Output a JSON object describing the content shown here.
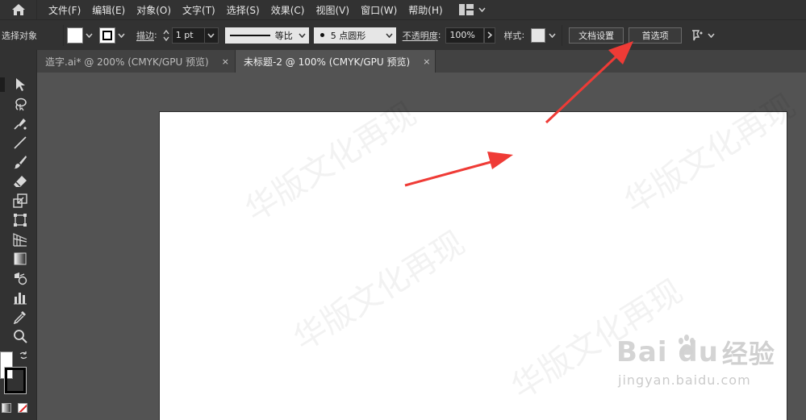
{
  "menubar": {
    "items": [
      "文件(F)",
      "编辑(E)",
      "对象(O)",
      "文字(T)",
      "选择(S)",
      "效果(C)",
      "视图(V)",
      "窗口(W)",
      "帮助(H)"
    ]
  },
  "control_bar": {
    "selection_label": "选择对象",
    "stroke_label": "描边",
    "stroke_weight": "1 pt",
    "profile_label": "等比",
    "brush_label": "5 点圆形",
    "opacity_label": "不透明度",
    "opacity_value": "100%",
    "style_label": "样式",
    "doc_setup_button": "文档设置",
    "preferences_button": "首选项"
  },
  "tabs": [
    {
      "label": "造字.ai* @ 200% (CMYK/GPU 预览)",
      "close": "×",
      "active": false
    },
    {
      "label": "未标题-2 @ 100% (CMYK/GPU 预览)",
      "close": "×",
      "active": true
    }
  ],
  "watermark": {
    "logo_text": "Bai  du",
    "logo_cn": "经验",
    "url": "jingyan.baidu.com",
    "faint_text": "华版文化再现"
  },
  "colors": {
    "chrome": "#323232",
    "panel": "#535353",
    "tab_inactive": "#424242",
    "artboard": "#ffffff",
    "annotation_arrow": "#ef3b36"
  }
}
